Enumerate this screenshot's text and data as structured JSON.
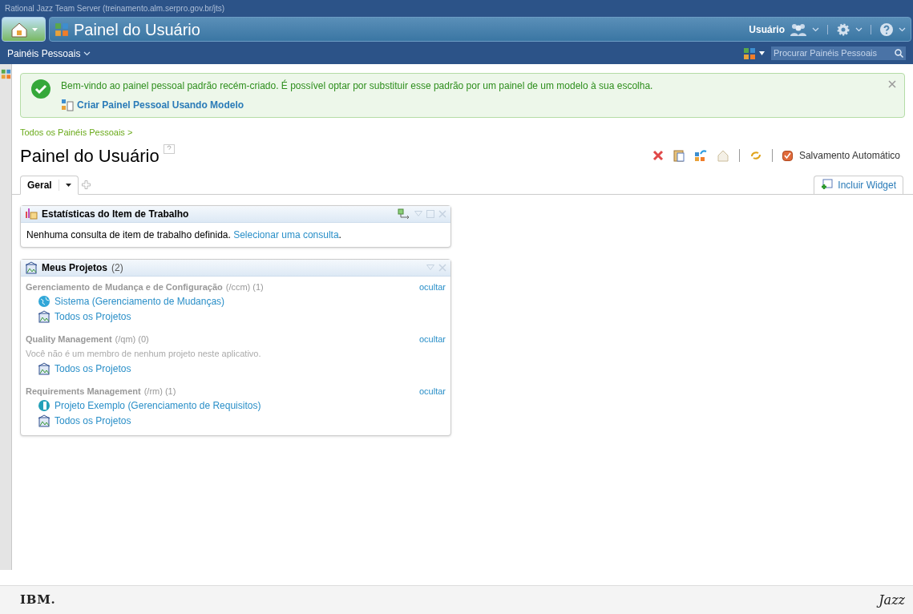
{
  "server_title": "Rational Jazz Team Server (treinamento.alm.serpro.gov.br/jts)",
  "banner": {
    "title": "Painel do Usuário",
    "user": "Usuário"
  },
  "nav": {
    "menu": "Painéis Pessoais",
    "search": {
      "placeholder": "Procurar Painéis Pessoais"
    }
  },
  "notice": {
    "message": "Bem-vindo ao painel pessoal padrão recém-criado. É possível optar por substituir esse padrão por um painel de um modelo à sua escolha.",
    "link": "Criar Painel Pessoal Usando Modelo"
  },
  "breadcrumb": "Todos os Painéis Pessoais >",
  "page_title": "Painel do Usuário",
  "autosave": {
    "label": "Salvamento Automático",
    "checked": true
  },
  "tabs": [
    {
      "label": "Geral",
      "selected": true
    }
  ],
  "add_widget": "Incluir Widget",
  "widgets": [
    {
      "kind": "stats",
      "title": "Estatísticas do Item de Trabalho",
      "text": "Nenhuma consulta de item de trabalho definida.",
      "link": "Selecionar uma consulta",
      "suffix": "."
    },
    {
      "kind": "projects",
      "title": "Meus Projetos",
      "count": "(2)",
      "sections": [
        {
          "name": "Gerenciamento de Mudança e de Configuração",
          "path": "(/ccm) (1)",
          "action": "ocultar",
          "items": [
            {
              "kind": "ccm",
              "label": "Sistema (Gerenciamento de Mudanças)"
            },
            {
              "kind": "all",
              "label": "Todos os Projetos"
            }
          ]
        },
        {
          "name": "Quality Management",
          "path": "(/qm) (0)",
          "action": "ocultar",
          "message": "Você não é um membro de nenhum projeto neste aplicativo.",
          "items": [
            {
              "kind": "all",
              "label": "Todos os Projetos"
            }
          ]
        },
        {
          "name": "Requirements Management",
          "path": "(/rm) (1)",
          "action": "ocultar",
          "items": [
            {
              "kind": "rm",
              "label": "Projeto Exemplo (Gerenciamento de Requisitos)"
            },
            {
              "kind": "all",
              "label": "Todos os Projetos"
            }
          ]
        }
      ]
    }
  ],
  "footer": {
    "left_logo": "IBM.",
    "right_logo": "Jazz"
  }
}
